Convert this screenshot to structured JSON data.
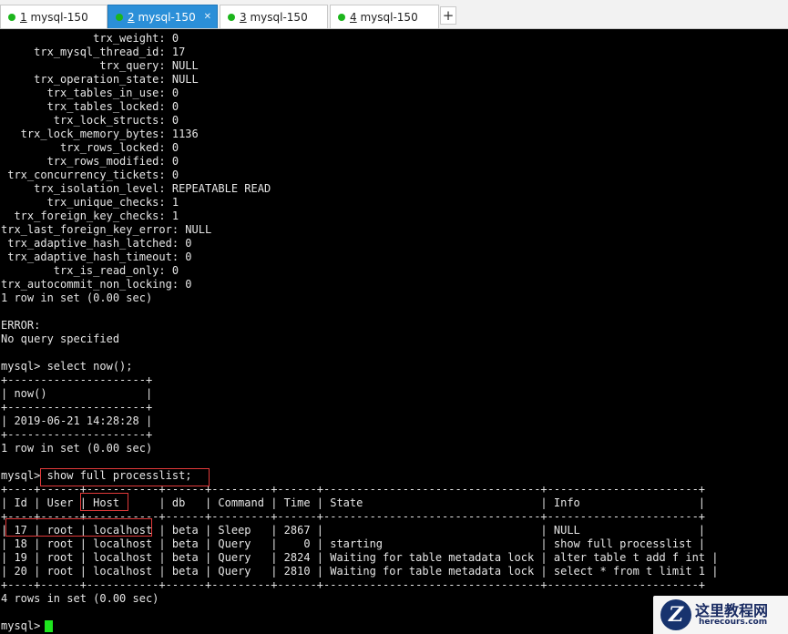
{
  "tabs": [
    {
      "number": "1",
      "label": "mysql-150",
      "active": false
    },
    {
      "number": "2",
      "label": "mysql-150",
      "active": true
    },
    {
      "number": "3",
      "label": "mysql-150",
      "active": false
    },
    {
      "number": "4",
      "label": "mysql-150",
      "active": false
    }
  ],
  "add_tab_label": "+",
  "terminal": {
    "lines": [
      "              trx_weight: 0",
      "     trx_mysql_thread_id: 17",
      "               trx_query: NULL",
      "     trx_operation_state: NULL",
      "       trx_tables_in_use: 0",
      "       trx_tables_locked: 0",
      "        trx_lock_structs: 0",
      "   trx_lock_memory_bytes: 1136",
      "         trx_rows_locked: 0",
      "       trx_rows_modified: 0",
      " trx_concurrency_tickets: 0",
      "     trx_isolation_level: REPEATABLE READ",
      "       trx_unique_checks: 1",
      "  trx_foreign_key_checks: 1",
      "trx_last_foreign_key_error: NULL",
      " trx_adaptive_hash_latched: 0",
      " trx_adaptive_hash_timeout: 0",
      "        trx_is_read_only: 0",
      "trx_autocommit_non_locking: 0",
      "1 row in set (0.00 sec)",
      "",
      "ERROR:",
      "No query specified",
      "",
      "mysql> select now();",
      "+---------------------+",
      "| now()               |",
      "+---------------------+",
      "| 2019-06-21 14:28:28 |",
      "+---------------------+",
      "1 row in set (0.00 sec)",
      "",
      "mysql> show full processlist;",
      "+----+------+-----------+------+---------+------+---------------------------------+-----------------------+",
      "| Id | User | Host      | db   | Command | Time | State                           | Info                  |",
      "+----+------+-----------+------+---------+------+---------------------------------+-----------------------+",
      "| 17 | root | localhost | beta | Sleep   | 2867 |                                 | NULL                  |",
      "| 18 | root | localhost | beta | Query   |    0 | starting                        | show full processlist |",
      "| 19 | root | localhost | beta | Query   | 2824 | Waiting for table metadata lock | alter table t add f int |",
      "| 20 | root | localhost | beta | Query   | 2810 | Waiting for table metadata lock | select * from t limit 1 |",
      "+----+------+-----------+------+---------+------+---------------------------------+-----------------------+",
      "4 rows in set (0.00 sec)",
      "",
      "mysql> "
    ]
  },
  "highlight_color": "#e23a3a",
  "cursor_color": "#1ee61e",
  "watermark": {
    "logo_letter": "Z",
    "title": "这里教程网",
    "url": "herecours.com"
  }
}
